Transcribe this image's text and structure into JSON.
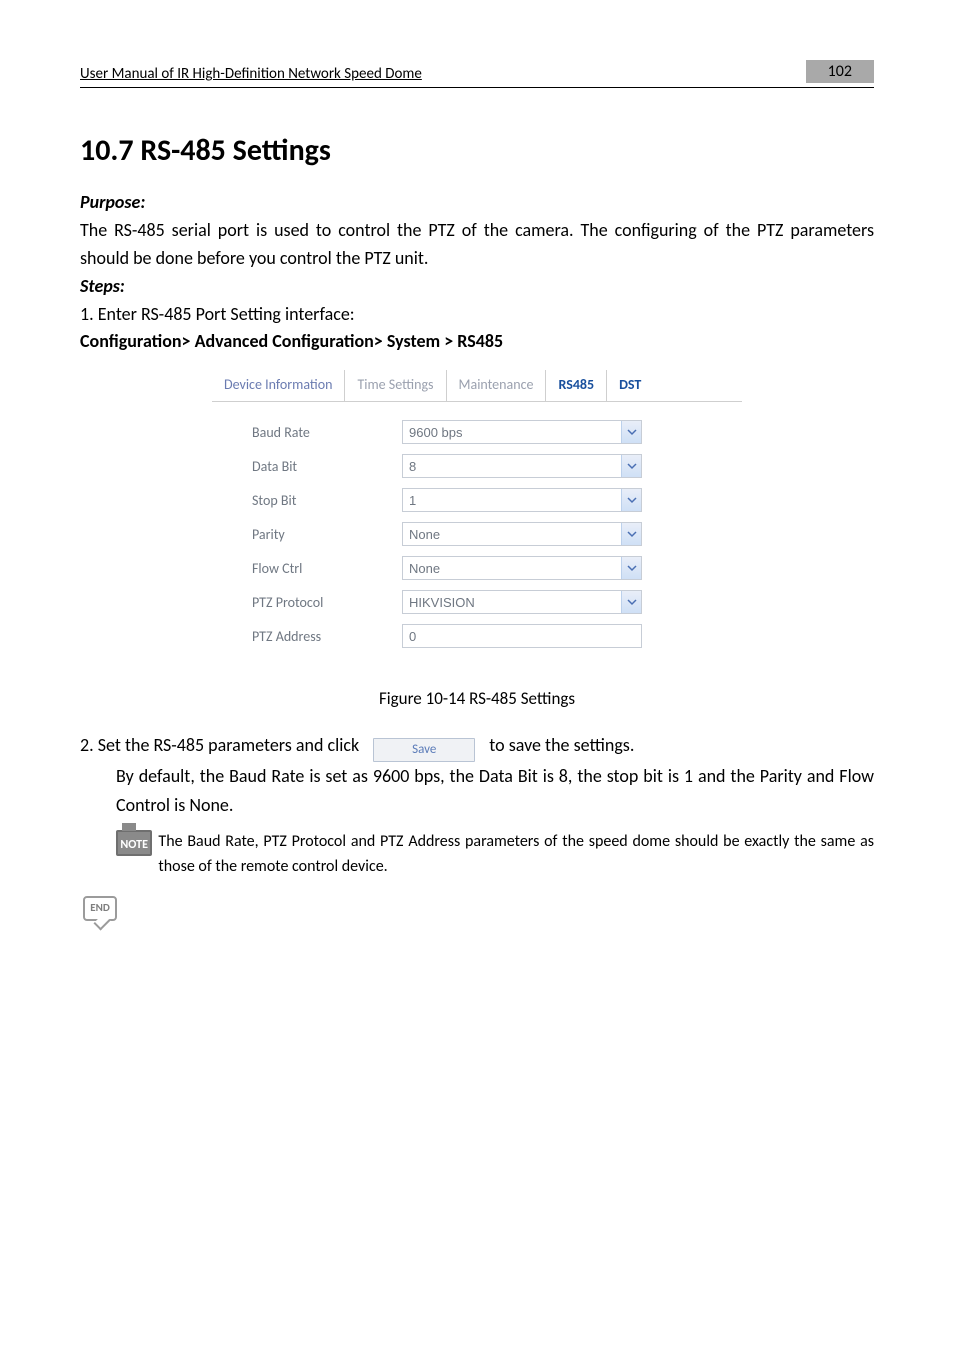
{
  "header": {
    "doc_title": "User Manual of IR High-Definition Network Speed Dome",
    "page_number": "102"
  },
  "section_title": "10.7 RS-485 Settings",
  "purpose_label": "Purpose:",
  "purpose_text": "The RS-485 serial port is used to control the PTZ of the camera. The configuring of the PTZ parameters should be done before you control the PTZ unit.",
  "steps_label": "Steps:",
  "step1": "1.  Enter RS-485 Port Setting interface:",
  "config_path": "Configuration> Advanced Configuration> System > RS485",
  "tabs": {
    "device_info": "Device Information",
    "time_settings": "Time Settings",
    "maintenance": "Maintenance",
    "rs485": "RS485",
    "dst": "DST"
  },
  "form": {
    "baud_rate": {
      "label": "Baud Rate",
      "value": "9600 bps"
    },
    "data_bit": {
      "label": "Data Bit",
      "value": "8"
    },
    "stop_bit": {
      "label": "Stop Bit",
      "value": "1"
    },
    "parity": {
      "label": "Parity",
      "value": "None"
    },
    "flow_ctrl": {
      "label": "Flow Ctrl",
      "value": "None"
    },
    "ptz_protocol": {
      "label": "PTZ Protocol",
      "value": "HIKVISION"
    },
    "ptz_address": {
      "label": "PTZ Address",
      "value": "0"
    }
  },
  "figure_caption": "Figure 10-14 RS-485 Settings",
  "step2_pre": "2.  Set the RS-485 parameters and click",
  "save_btn": "Save",
  "step2_post": "to save the settings.",
  "default_text": "By default, the Baud Rate is set as 9600 bps, the Data Bit is 8, the stop bit is 1 and the Parity and Flow Control is None.",
  "note_text": "The Baud Rate, PTZ Protocol and PTZ Address parameters of the speed dome should be exactly the same as those of the remote control device.",
  "end_label": "END"
}
